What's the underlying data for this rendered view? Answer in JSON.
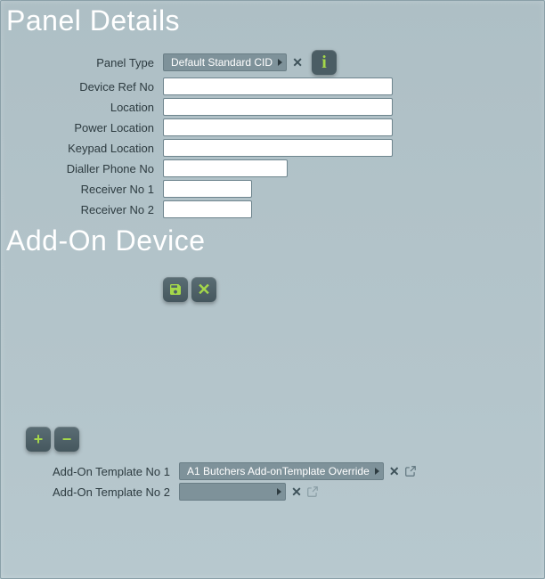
{
  "headings": {
    "panel_details": "Panel Details",
    "addon_device": "Add-On Device"
  },
  "panel": {
    "labels": {
      "panel_type": "Panel Type",
      "device_ref_no": "Device Ref No",
      "location": "Location",
      "power_location": "Power Location",
      "keypad_location": "Keypad Location",
      "dialler_phone_no": "Dialler Phone No",
      "receiver_no_1": "Receiver No 1",
      "receiver_no_2": "Receiver No 2"
    },
    "values": {
      "panel_type": "Default Standard CID",
      "device_ref_no": "",
      "location": "",
      "power_location": "",
      "keypad_location": "",
      "dialler_phone_no": "",
      "receiver_no_1": "",
      "receiver_no_2": ""
    }
  },
  "addon": {
    "labels": {
      "template_no_1": "Add-On Template No 1",
      "template_no_2": "Add-On Template No 2"
    },
    "values": {
      "template_no_1": "A1 Butchers Add-onTemplate Override",
      "template_no_2": ""
    }
  },
  "icons": {
    "clear": "✕",
    "info": "i",
    "external": "⧉",
    "plus": "+",
    "minus": "−",
    "save": "💾",
    "cancel": "✕"
  }
}
